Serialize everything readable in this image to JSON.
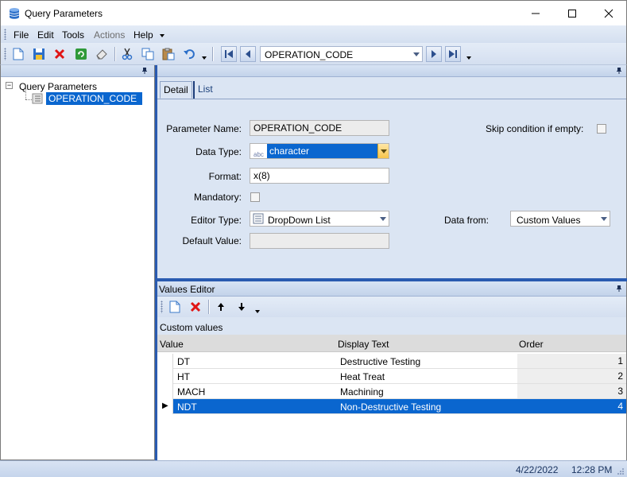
{
  "window": {
    "title": "Query Parameters"
  },
  "menu": {
    "items": [
      {
        "label": "File",
        "enabled": true
      },
      {
        "label": "Edit",
        "enabled": true
      },
      {
        "label": "Tools",
        "enabled": true
      },
      {
        "label": "Actions",
        "enabled": false
      },
      {
        "label": "Help",
        "enabled": true
      }
    ]
  },
  "toolbar": {
    "record_selector": "OPERATION_CODE"
  },
  "tree": {
    "root": "Query Parameters",
    "child": "OPERATION_CODE"
  },
  "detail": {
    "tabs": [
      {
        "label": "Detail",
        "active": true
      },
      {
        "label": "List",
        "active": false
      }
    ],
    "parameter_name_label": "Parameter Name:",
    "parameter_name_value": "OPERATION_CODE",
    "skip_condition_label": "Skip condition if empty:",
    "skip_condition_checked": false,
    "data_type_label": "Data Type:",
    "data_type_icon_text": "abc",
    "data_type_value": "character",
    "format_label": "Format:",
    "format_value": "x(8)",
    "mandatory_label": "Mandatory:",
    "mandatory_checked": false,
    "editor_type_label": "Editor Type:",
    "editor_type_value": "DropDown List",
    "data_from_label": "Data from:",
    "data_from_value": "Custom Values",
    "default_value_label": "Default Value:",
    "default_value_value": ""
  },
  "values_editor": {
    "title": "Values Editor",
    "caption": "Custom values",
    "columns": [
      "Value",
      "Display Text",
      "Order"
    ],
    "rows": [
      {
        "value": "DT",
        "display": "Destructive Testing",
        "order": "1"
      },
      {
        "value": "HT",
        "display": "Heat Treat",
        "order": "2"
      },
      {
        "value": "MACH",
        "display": "Machining",
        "order": "3"
      },
      {
        "value": "NDT",
        "display": "Non-Destructive Testing",
        "order": "4"
      }
    ],
    "selected_row_indicator": "▶"
  },
  "status": {
    "date": "4/22/2022",
    "time": "12:28 PM"
  },
  "colors": {
    "selection": "#0a66cf",
    "panel_bg": "#dbe5f3",
    "splitter": "#2a5bb0"
  }
}
